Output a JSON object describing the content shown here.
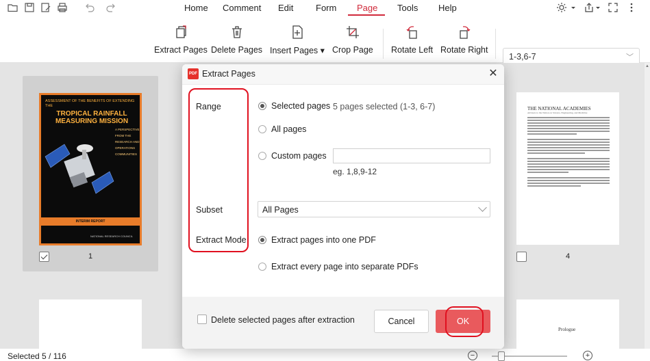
{
  "menubar": {
    "items": [
      "Home",
      "Comment",
      "Edit",
      "Form",
      "Page",
      "Tools",
      "Help"
    ],
    "active": "Page"
  },
  "ribbon": {
    "tools": [
      {
        "label": "Extract Pages",
        "icon": "extract-pages-icon"
      },
      {
        "label": "Delete Pages",
        "icon": "trash-icon"
      },
      {
        "label": "Insert Pages ▾",
        "icon": "insert-page-icon"
      },
      {
        "label": "Crop Page",
        "icon": "crop-icon"
      },
      {
        "label": "Rotate Left",
        "icon": "rotate-left-icon"
      },
      {
        "label": "Rotate Right",
        "icon": "rotate-right-icon"
      }
    ],
    "page_range_value": "1-3,6-7"
  },
  "thumbnails": {
    "page1": {
      "number": "1",
      "title_small": "Assessment of the Benefits of Extending the",
      "title_big": "TROPICAL RAINFALL MEASURING MISSION",
      "side_text": "A PERSPECTIVE FROM THE RESEARCH AND OPERATIONS COMMUNITIES",
      "band": "INTERIM REPORT",
      "footer": "NATIONAL RESEARCH COUNCIL"
    },
    "page4": {
      "number": "4",
      "heading": "THE NATIONAL ACADEMIES",
      "subheading": "Advisers to the Nation on Science, Engineering, and Medicine"
    },
    "prologue": "Prologue"
  },
  "dialog": {
    "title": "Extract Pages",
    "range_label": "Range",
    "selected_pages_label": "Selected pages",
    "selected_pages_info": "5  pages selected (1-3, 6-7)",
    "all_pages_label": "All pages",
    "custom_pages_label": "Custom pages",
    "custom_pages_value": "",
    "custom_pages_hint": "eg. 1,8,9-12",
    "subset_label": "Subset",
    "subset_value": "All Pages",
    "extract_mode_label": "Extract Mode",
    "mode_one_pdf": "Extract pages into one PDF",
    "mode_separate": "Extract every page into separate PDFs",
    "delete_after_label": "Delete selected pages after extraction",
    "cancel_label": "Cancel",
    "ok_label": "OK"
  },
  "status": {
    "text": "Selected   5  /  116"
  },
  "colors": {
    "accent": "#d0293a",
    "ok_button": "#e95a5d",
    "highlight": "#e0101f",
    "cover_border": "#e87c2a"
  }
}
